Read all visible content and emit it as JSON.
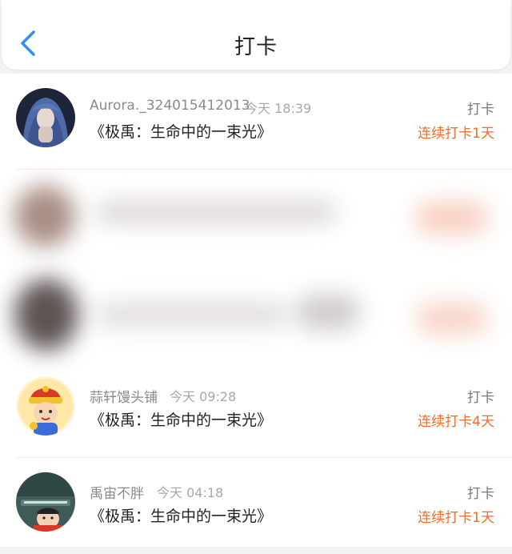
{
  "header": {
    "title": "打卡",
    "back_icon": "chevron-left-icon",
    "accent": "#2f8ff0"
  },
  "items": [
    {
      "name": "Aurora._324015412013",
      "time": "今天 18:39",
      "book": "《极禹：生命中的一束光》",
      "action": "打卡",
      "streak": "连续打卡1天"
    },
    {
      "name": "蒜轩馒头铺",
      "time": "今天 09:28",
      "book": "《极禹：生命中的一束光》",
      "action": "打卡",
      "streak": "连续打卡4天"
    },
    {
      "name": "禹宙不胖",
      "time": "今天 04:18",
      "book": "《极禹：生命中的一束光》",
      "action": "打卡",
      "streak": "连续打卡1天"
    }
  ],
  "colors": {
    "streak": "#f26b2b",
    "name": "#8a8a8a",
    "text": "#222222"
  }
}
